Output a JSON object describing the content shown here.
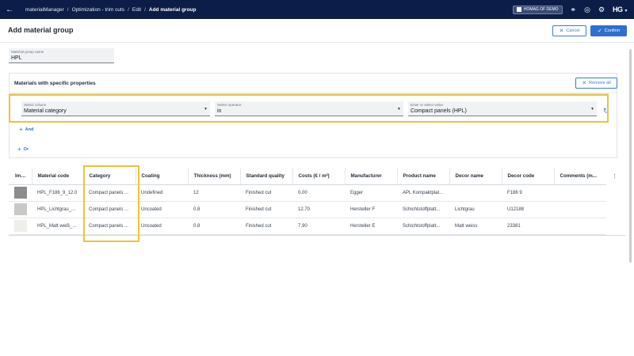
{
  "topbar": {
    "breadcrumbs": [
      "materialManager",
      "Optimization - trim cuts",
      "Edit",
      "Add material group"
    ],
    "org_label": "HOMAG OF DEMO",
    "logo": "HG"
  },
  "page": {
    "title": "Add material group",
    "cancel_label": "Cancel",
    "confirm_label": "Confirm"
  },
  "name_field": {
    "label": "Material group name",
    "value": "HPL"
  },
  "materials": {
    "title": "Materials with specific properties",
    "remove_all_label": "Remove all",
    "condition": {
      "column_label": "Select column",
      "column_value": "Material category",
      "operator_label": "Select operator",
      "operator_value": "in",
      "value_label": "Enter or select value",
      "value_value": "Compact panels (HPL)"
    },
    "and_label": "And",
    "or_label": "Or"
  },
  "table": {
    "columns": [
      "Ima...",
      "Material code",
      "Category",
      "Coating",
      "Thickness (mm)",
      "Standard quality",
      "Costs (€ / m²)",
      "Manufacturer",
      "Product name",
      "Decor name",
      "Decor code",
      "Comments (m..."
    ],
    "rows": [
      {
        "thumb_color": "#8c8c8c",
        "code": "HPL_F186_9_12.0",
        "category": "Compact panels ...",
        "coating": "Undefined",
        "thickness": "12",
        "quality": "Finished cut",
        "cost": "0.00",
        "manufacturer": "Egger",
        "product": "APL Kompaktplat...",
        "decor_name": "",
        "decor_code": "F186 9",
        "comments": ""
      },
      {
        "thumb_color": "#c8c8c6",
        "code": "HPL_Lichtgrau_...",
        "category": "Compact panels ...",
        "coating": "Uncoated",
        "thickness": "0.8",
        "quality": "Finished cut",
        "cost": "12.70",
        "manufacturer": "Hersteller F",
        "product": "Schichtstoffplatt...",
        "decor_name": "Lichtgrau",
        "decor_code": "U12188",
        "comments": ""
      },
      {
        "thumb_color": "#f0eeea",
        "code": "HPL_Matt weiß_...",
        "category": "Compact panels ...",
        "coating": "Uncoated",
        "thickness": "0.8",
        "quality": "Finished cut",
        "cost": "7.90",
        "manufacturer": "Hersteller E",
        "product": "Schichtstoffplatt...",
        "decor_name": "Matt weiss",
        "decor_code": "23381",
        "comments": ""
      }
    ]
  },
  "colors": {
    "topbar": "#0c1d48",
    "accent": "#2f6fd1",
    "highlight": "#e9c53a"
  }
}
